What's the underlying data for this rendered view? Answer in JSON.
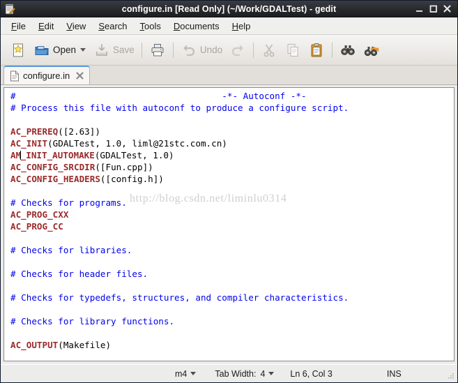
{
  "window": {
    "title": "configure.in [Read Only] (~/Work/GDALTest) - gedit",
    "app_icon": "gedit-notepad-pencil-icon",
    "buttons": {
      "minimize": "minimize-button",
      "maximize": "maximize-button",
      "close": "close-button"
    }
  },
  "menubar": {
    "items": [
      {
        "label": "File",
        "mnemonic": "F"
      },
      {
        "label": "Edit",
        "mnemonic": "E"
      },
      {
        "label": "View",
        "mnemonic": "V"
      },
      {
        "label": "Search",
        "mnemonic": "S"
      },
      {
        "label": "Tools",
        "mnemonic": "T"
      },
      {
        "label": "Documents",
        "mnemonic": "D"
      },
      {
        "label": "Help",
        "mnemonic": "H"
      }
    ]
  },
  "toolbar": {
    "new_label": "",
    "open_label": "Open",
    "save_label": "Save",
    "undo_label": "Undo",
    "items": [
      {
        "name": "new-document-button",
        "icon": "new-document-icon",
        "enabled": true
      },
      {
        "name": "open-button",
        "icon": "open-folder-icon",
        "enabled": true
      },
      {
        "name": "save-button",
        "icon": "save-icon",
        "enabled": false
      },
      {
        "name": "print-button",
        "icon": "printer-icon",
        "enabled": true
      },
      {
        "name": "undo-button",
        "icon": "undo-arrow-icon",
        "enabled": false
      },
      {
        "name": "redo-button",
        "icon": "redo-arrow-icon",
        "enabled": false
      },
      {
        "name": "cut-button",
        "icon": "scissors-icon",
        "enabled": false
      },
      {
        "name": "copy-button",
        "icon": "copy-icon",
        "enabled": false
      },
      {
        "name": "paste-button",
        "icon": "clipboard-icon",
        "enabled": true
      },
      {
        "name": "find-button",
        "icon": "binoculars-icon",
        "enabled": true
      },
      {
        "name": "replace-button",
        "icon": "find-replace-icon",
        "enabled": true
      }
    ]
  },
  "tabs": [
    {
      "label": "configure.in",
      "icon": "text-file-icon",
      "close": "close-tab-icon",
      "active": true
    }
  ],
  "editor": {
    "watermark": "http://blog.csdn.net/liminlu0314",
    "cursor_line": 6,
    "cursor_col": 3,
    "lines": [
      {
        "n": 1,
        "segments": [
          {
            "t": "#                                       -*- Autoconf -*-",
            "c": "cm"
          }
        ]
      },
      {
        "n": 2,
        "segments": [
          {
            "t": "# Process this file with autoconf to produce a configure script.",
            "c": "cm"
          }
        ]
      },
      {
        "n": 3,
        "segments": []
      },
      {
        "n": 4,
        "segments": [
          {
            "t": "AC_PREREQ",
            "c": "mac"
          },
          {
            "t": "([2.63])",
            "c": ""
          }
        ]
      },
      {
        "n": 5,
        "segments": [
          {
            "t": "AC_INIT",
            "c": "mac"
          },
          {
            "t": "(GDALTest, 1.0, liml@21stc.com.cn)",
            "c": ""
          }
        ]
      },
      {
        "n": 6,
        "segments": [
          {
            "t": "AM",
            "c": "mac"
          },
          {
            "t": "",
            "c": "cursor"
          },
          {
            "t": "_INIT_AUTOMAKE",
            "c": "mac"
          },
          {
            "t": "(GDALTest, 1.0)",
            "c": ""
          }
        ]
      },
      {
        "n": 7,
        "segments": [
          {
            "t": "AC_CONFIG_SRCDIR",
            "c": "mac"
          },
          {
            "t": "([Fun.cpp])",
            "c": ""
          }
        ]
      },
      {
        "n": 8,
        "segments": [
          {
            "t": "AC_CONFIG_HEADERS",
            "c": "mac"
          },
          {
            "t": "([config.h])",
            "c": ""
          }
        ]
      },
      {
        "n": 9,
        "segments": []
      },
      {
        "n": 10,
        "segments": [
          {
            "t": "# Checks for programs.",
            "c": "cm"
          }
        ]
      },
      {
        "n": 11,
        "segments": [
          {
            "t": "AC_PROG_CXX",
            "c": "mac"
          }
        ]
      },
      {
        "n": 12,
        "segments": [
          {
            "t": "AC_PROG_CC",
            "c": "mac"
          }
        ]
      },
      {
        "n": 13,
        "segments": []
      },
      {
        "n": 14,
        "segments": [
          {
            "t": "# Checks for libraries.",
            "c": "cm"
          }
        ]
      },
      {
        "n": 15,
        "segments": []
      },
      {
        "n": 16,
        "segments": [
          {
            "t": "# Checks for header files.",
            "c": "cm"
          }
        ]
      },
      {
        "n": 17,
        "segments": []
      },
      {
        "n": 18,
        "segments": [
          {
            "t": "# Checks for typedefs, structures, and compiler characteristics.",
            "c": "cm"
          }
        ]
      },
      {
        "n": 19,
        "segments": []
      },
      {
        "n": 20,
        "segments": [
          {
            "t": "# Checks for library functions.",
            "c": "cm"
          }
        ]
      },
      {
        "n": 21,
        "segments": []
      },
      {
        "n": 22,
        "segments": [
          {
            "t": "AC_OUTPUT",
            "c": "mac"
          },
          {
            "t": "(Makefile)",
            "c": ""
          }
        ]
      }
    ]
  },
  "statusbar": {
    "language": "m4",
    "tab_width_label": "Tab Width:",
    "tab_width_value": "4",
    "position": "Ln 6, Col 3",
    "insert_mode": "INS"
  },
  "colors": {
    "comment": "#0000ee",
    "macro": "#9b2b2b",
    "plain": "#000000",
    "watermark": "#cfcfcf",
    "tab_accent": "#5b9bd8",
    "titlebar": "#2c2d31"
  }
}
